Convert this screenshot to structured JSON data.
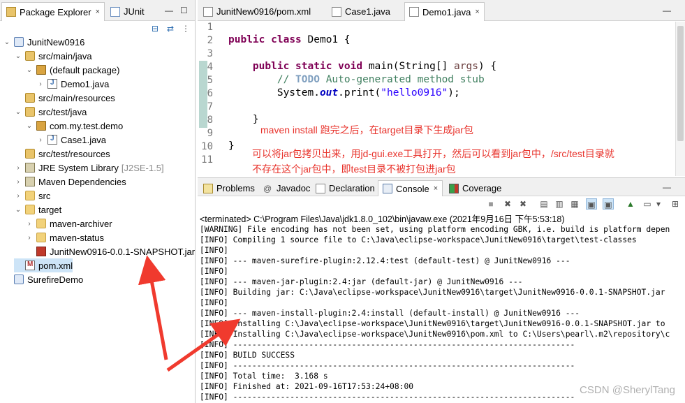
{
  "explorer": {
    "tabs": [
      {
        "label": "Package Explorer",
        "close": "×"
      },
      {
        "label": "JUnit"
      }
    ],
    "tree": [
      {
        "label": "JunitNew0916",
        "icon": "project-icon",
        "indent": 0,
        "tw": "v"
      },
      {
        "label": "src/main/java",
        "icon": "source-folder-icon",
        "indent": 1,
        "tw": "v"
      },
      {
        "label": "(default package)",
        "icon": "package-icon",
        "indent": 2,
        "tw": "v"
      },
      {
        "label": "Demo1.java",
        "icon": "java-file-icon",
        "indent": 3,
        "tw": ">"
      },
      {
        "label": "src/main/resources",
        "icon": "source-folder-icon",
        "indent": 1,
        "tw": ""
      },
      {
        "label": "src/test/java",
        "icon": "source-folder-icon",
        "indent": 1,
        "tw": "v"
      },
      {
        "label": "com.my.test.demo",
        "icon": "package-icon",
        "indent": 2,
        "tw": "v"
      },
      {
        "label": "Case1.java",
        "icon": "java-file-icon",
        "indent": 3,
        "tw": ">"
      },
      {
        "label": "src/test/resources",
        "icon": "source-folder-icon",
        "indent": 1,
        "tw": ""
      },
      {
        "label": "JRE System Library",
        "extra": "[J2SE-1.5]",
        "icon": "library-icon",
        "indent": 1,
        "tw": ">"
      },
      {
        "label": "Maven Dependencies",
        "icon": "library-icon",
        "indent": 1,
        "tw": ">"
      },
      {
        "label": "src",
        "icon": "folder-icon",
        "indent": 1,
        "tw": ">"
      },
      {
        "label": "target",
        "icon": "folder-icon",
        "indent": 1,
        "tw": "v"
      },
      {
        "label": "maven-archiver",
        "icon": "folder-icon",
        "indent": 2,
        "tw": ">"
      },
      {
        "label": "maven-status",
        "icon": "folder-icon",
        "indent": 2,
        "tw": ">"
      },
      {
        "label": "JunitNew0916-0.0.1-SNAPSHOT.jar",
        "icon": "jar-icon",
        "indent": 2,
        "tw": ""
      },
      {
        "label": "pom.xml",
        "icon": "xml-file-icon",
        "indent": 1,
        "tw": "",
        "selected": true
      },
      {
        "label": "SurefireDemo",
        "icon": "project-icon",
        "indent": 0,
        "tw": ""
      }
    ]
  },
  "editor": {
    "tabs": [
      {
        "label": "JunitNew0916/pom.xml"
      },
      {
        "label": "Case1.java"
      },
      {
        "label": "Demo1.java",
        "close": "×"
      }
    ],
    "line_numbers": [
      "1",
      "2",
      "3",
      "4",
      "5",
      "6",
      "7",
      "8",
      "9",
      "10",
      "11"
    ],
    "code": {
      "l2_kw1": "public",
      "l2_kw2": "class",
      "l2_rest": " Demo1 {",
      "l4_kw1": "public",
      "l4_kw2": "static",
      "l4_kw3": "void",
      "l4_rest1": " main(String[] ",
      "l4_args": "args",
      "l4_rest2": ") {",
      "l5_slash": "// ",
      "l5_todo": "TODO",
      "l5_rest": " Auto-generated method stub",
      "l6_a": "System.",
      "l6_out": "out",
      "l6_b": ".print(",
      "l6_str": "\"hello0916\"",
      "l6_c": ");",
      "l8": "}",
      "l10": "}"
    },
    "annotations": {
      "a1": "maven install 跑完之后，在target目录下生成jar包",
      "a2": "可以将jar包拷贝出来，用jd-gui.exe工具打开，然后可以看到jar包中，/src/test目录就",
      "a3": "不存在这个jar包中，即test目录不被打包进jar包"
    }
  },
  "console": {
    "tabs": [
      {
        "label": "Problems"
      },
      {
        "label": "Javadoc"
      },
      {
        "label": "Declaration"
      },
      {
        "label": "Console",
        "close": "×"
      },
      {
        "label": "Coverage"
      }
    ],
    "terminated": "<terminated> C:\\Program Files\\Java\\jdk1.8.0_102\\bin\\javaw.exe (2021年9月16日 下午5:53:18)",
    "lines": [
      "[WARNING] File encoding has not been set, using platform encoding GBK, i.e. build is platform depen",
      "[INFO] Compiling 1 source file to C:\\Java\\eclipse-workspace\\JunitNew0916\\target\\test-classes",
      "[INFO]",
      "[INFO] --- maven-surefire-plugin:2.12.4:test (default-test) @ JunitNew0916 ---",
      "[INFO]",
      "[INFO] --- maven-jar-plugin:2.4:jar (default-jar) @ JunitNew0916 ---",
      "[INFO] Building jar: C:\\Java\\eclipse-workspace\\JunitNew0916\\target\\JunitNew0916-0.0.1-SNAPSHOT.jar",
      "[INFO]",
      "[INFO] --- maven-install-plugin:2.4:install (default-install) @ JunitNew0916 ---",
      "[INFO] Installing C:\\Java\\eclipse-workspace\\JunitNew0916\\target\\JunitNew0916-0.0.1-SNAPSHOT.jar to",
      "[INFO] Installing C:\\Java\\eclipse-workspace\\JunitNew0916\\pom.xml to C:\\Users\\pearl\\.m2\\repository\\c",
      "[INFO] ------------------------------------------------------------------------",
      "[INFO] BUILD SUCCESS",
      "[INFO] ------------------------------------------------------------------------",
      "[INFO] Total time:  3.168 s",
      "[INFO] Finished at: 2021-09-16T17:53:24+08:00",
      "[INFO] ------------------------------------------------------------------------"
    ]
  },
  "watermark": "CSDN @SherylTang",
  "colors": {
    "annotation": "#e8342d",
    "keyword": "#7f0055",
    "comment": "#3f7f5f",
    "string": "#2a00ff"
  }
}
